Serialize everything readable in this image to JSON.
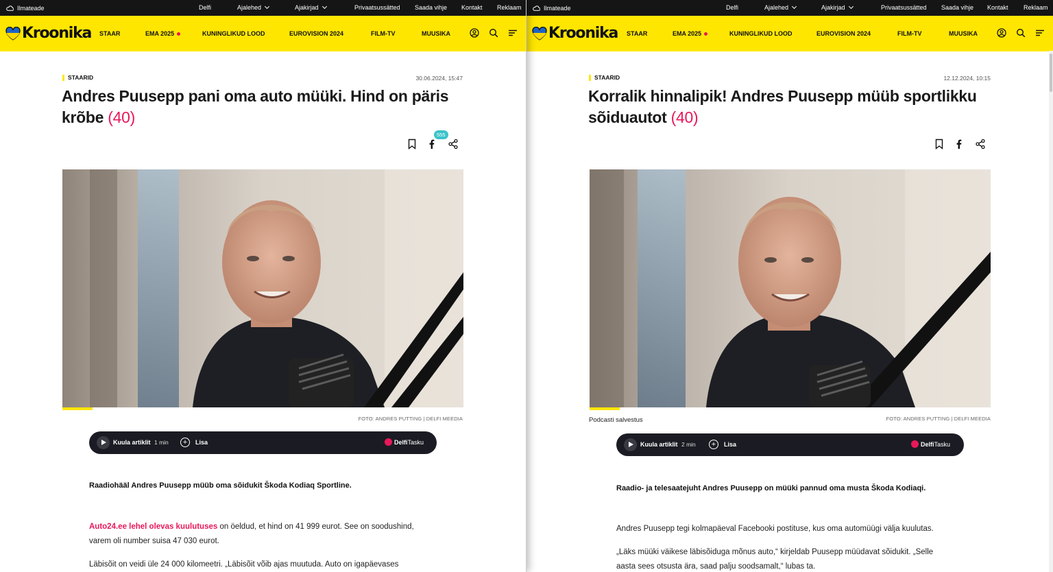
{
  "left": {
    "topbar": {
      "weather": "Ilmateade",
      "links": [
        "Delfi",
        "Ajalehed",
        "Ajakirjad",
        "Privaatsussätted",
        "Saada vihje",
        "Kontakt",
        "Reklaam"
      ]
    },
    "nav": {
      "logo": "Kroonika",
      "items": [
        "STAAR",
        "EMA 2025",
        "KUNINGLIKUD LOOD",
        "EUROVISION 2024",
        "FILM-TV",
        "MUUSIKA"
      ]
    },
    "article": {
      "kicker": "STAARID",
      "date": "30.06.2024, 15:47",
      "title": "Andres Puusepp pani oma auto müüki. Hind on päris krõbe",
      "comment_count": "(40)",
      "share_badge": "555",
      "credit": "FOTO: ANDRES PUTTING | DELFI MEEDIA",
      "player": {
        "listen": "Kuula artiklit",
        "duration": "1 min",
        "add": "Lisa",
        "brand_bold": "Delfi",
        "brand_light": "Tasku"
      },
      "lead": "Raadiohääl Andres Puusepp müüb oma sõidukit Škoda Kodiaq Sportline.",
      "p1_link": "Auto24.ee lehel olevas kuulutuses",
      "p1_rest": " on öeldud, et hind on 41 999 eurot. See on soodushind, varem oli number suisa 47 030 eurot.",
      "p2": "Läbisõit on veidi üle 24 000 kilomeetri. „Läbisõit võib ajas muutuda. Auto on igapäevases"
    }
  },
  "right": {
    "topbar": {
      "weather": "Ilmateade",
      "links": [
        "Delfi",
        "Ajalehed",
        "Ajakirjad",
        "Privaatsussätted",
        "Saada vihje",
        "Kontakt",
        "Reklaam"
      ]
    },
    "nav": {
      "logo": "Kroonika",
      "items": [
        "STAAR",
        "EMA 2025",
        "KUNINGLIKUD LOOD",
        "EUROVISION 2024",
        "FILM-TV",
        "MUUSIKA"
      ]
    },
    "article": {
      "kicker": "STAARID",
      "date": "12.12.2024, 10:15",
      "title": "Korralik hinnalipik! Andres Puusepp müüb sportlikku sõiduautot",
      "comment_count": "(40)",
      "caption": "Podcasti salvestus",
      "credit": "FOTO: ANDRES PUTTING | DELFI MEEDIA",
      "player": {
        "listen": "Kuula artiklit",
        "duration": "2 min",
        "add": "Lisa",
        "brand_bold": "Delfi",
        "brand_light": "Tasku"
      },
      "lead": "Raadio- ja telesaatejuht Andres Puusepp on müüki pannud oma musta Škoda Kodiaqi.",
      "p1": "Andres Puusepp tegi kolmapäeval Facebooki postituse, kus oma automüügi välja kuulutas.",
      "p2": "„Läks müüki väikese läbisõiduga mõnus auto,“ kirjeldab Puusepp müüdavat sõidukit. „Selle aasta sees otsusta ära, saad palju soodsamalt,“ lubas ta."
    }
  },
  "colors": {
    "brand_yellow": "#ffe600",
    "accent_pink": "#e8185b",
    "badge_teal": "#3bc3c9",
    "topbar": "#151515",
    "player": "#1b1c23"
  },
  "icons": [
    "cloud-icon",
    "heart-logo-icon",
    "user-icon",
    "search-icon",
    "menu-icon",
    "bookmark-icon",
    "facebook-icon",
    "share-icon",
    "play-icon",
    "plus-circle-icon",
    "tasku-icon"
  ]
}
